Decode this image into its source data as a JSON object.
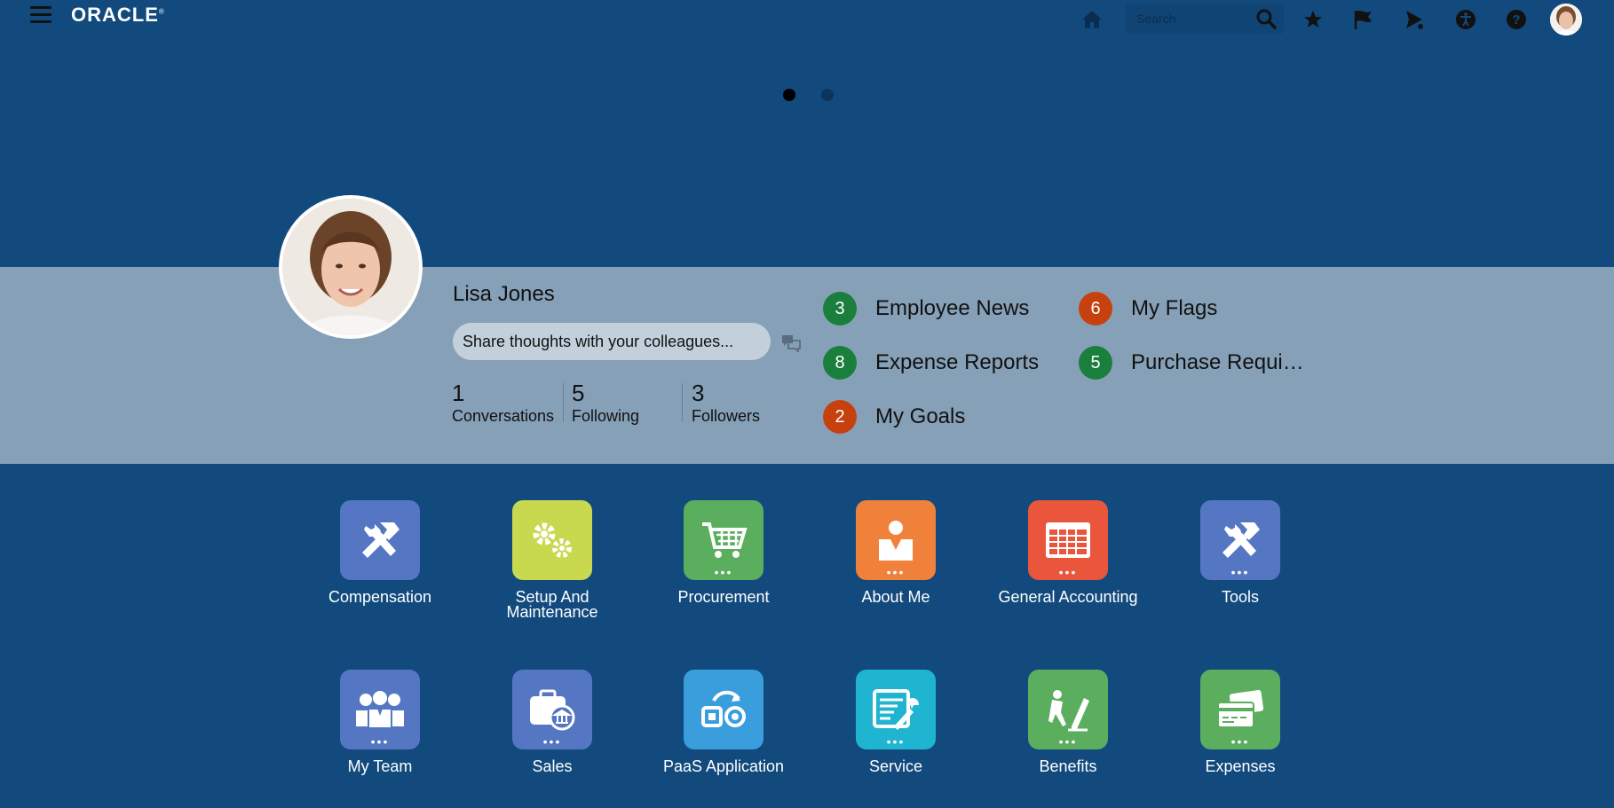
{
  "header": {
    "brand": "ORACLE",
    "search_placeholder": "Search",
    "icons": [
      "menu-icon",
      "home-icon",
      "search-icon",
      "star-icon",
      "flag-icon",
      "bell-icon",
      "accessibility-icon",
      "help-icon"
    ]
  },
  "carousel": {
    "active_page": 1,
    "pages": 2
  },
  "profile": {
    "name": "Lisa Jones",
    "share_placeholder": "Share thoughts with your colleagues...",
    "stats": [
      {
        "num": "1",
        "label": "Conversations"
      },
      {
        "num": "5",
        "label": "Following"
      },
      {
        "num": "3",
        "label": "Followers"
      }
    ]
  },
  "notifications": [
    {
      "count": "3",
      "label": "Employee News",
      "color": "#1a7f3c"
    },
    {
      "count": "6",
      "label": "My Flags",
      "color": "#c7410f"
    },
    {
      "count": "8",
      "label": "Expense Reports",
      "color": "#1a7f3c"
    },
    {
      "count": "5",
      "label": "Purchase Requi…",
      "color": "#1a7f3c"
    },
    {
      "count": "2",
      "label": "My Goals",
      "color": "#c7410f"
    }
  ],
  "apps": [
    {
      "label": "Compensation",
      "color": "#5577c3",
      "icon": "tools-icon",
      "dots": false
    },
    {
      "label": "Setup And Maintenance",
      "color": "#c8d94f",
      "icon": "gears-icon",
      "dots": false
    },
    {
      "label": "Procurement",
      "color": "#5aae5e",
      "icon": "cart-icon",
      "dots": true
    },
    {
      "label": "About Me",
      "color": "#f0813a",
      "icon": "person-icon",
      "dots": true
    },
    {
      "label": "General Accounting",
      "color": "#e9563c",
      "icon": "ledger-icon",
      "dots": true
    },
    {
      "label": "Tools",
      "color": "#5577c3",
      "icon": "tools-icon",
      "dots": true
    },
    {
      "label": "My Team",
      "color": "#5577c3",
      "icon": "team-icon",
      "dots": true
    },
    {
      "label": "Sales",
      "color": "#5577c3",
      "icon": "sales-icon",
      "dots": true
    },
    {
      "label": "PaaS Application",
      "color": "#3a9ddc",
      "icon": "paas-icon",
      "dots": false
    },
    {
      "label": "Service",
      "color": "#1fb5d0",
      "icon": "service-icon",
      "dots": true
    },
    {
      "label": "Benefits",
      "color": "#5aae5e",
      "icon": "benefits-icon",
      "dots": true
    },
    {
      "label": "Expenses",
      "color": "#5aae5e",
      "icon": "expenses-icon",
      "dots": true
    }
  ]
}
